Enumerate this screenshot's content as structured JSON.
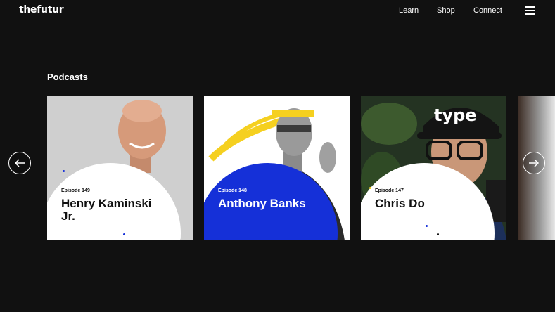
{
  "header": {
    "logo": "thefutur",
    "nav": [
      {
        "label": "Learn"
      },
      {
        "label": "Shop"
      },
      {
        "label": "Connect"
      }
    ],
    "menu_icon": "hamburger-icon"
  },
  "section": {
    "title": "Podcasts"
  },
  "carousel": {
    "prev_icon": "arrow-left-icon",
    "next_icon": "arrow-right-icon",
    "episodes": [
      {
        "episode": "Episode 149",
        "name": "Henry Kaminski Jr.",
        "badge_color": "#ffffff"
      },
      {
        "episode": "Episode 148",
        "name": "Anthony Banks",
        "badge_color": "#1530d8"
      },
      {
        "episode": "Episode 147",
        "name": "Chris Do",
        "badge_color": "#ffffff"
      }
    ]
  },
  "colors": {
    "background": "#111111",
    "accent_blue": "#1530d8",
    "accent_yellow": "#f5d020"
  }
}
